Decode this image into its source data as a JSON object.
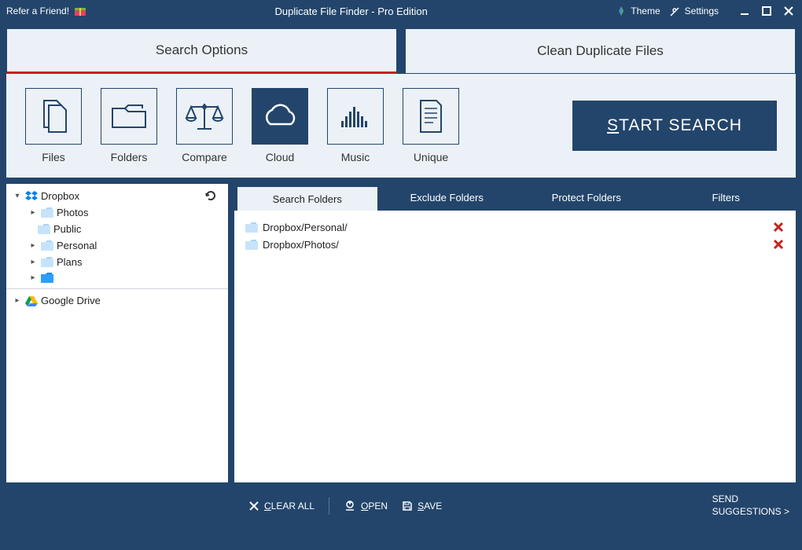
{
  "titlebar": {
    "refer": "Refer a Friend!",
    "app_title": "Duplicate File Finder - Pro Edition",
    "theme": "Theme",
    "settings": "Settings"
  },
  "main_tabs": {
    "search_options": "Search Options",
    "clean_duplicates": "Clean Duplicate Files"
  },
  "toolbar": {
    "files": "Files",
    "folders": "Folders",
    "compare": "Compare",
    "cloud": "Cloud",
    "music": "Music",
    "unique": "Unique",
    "start_prefix": "S",
    "start_rest": "TART SEARCH"
  },
  "tree": {
    "dropbox": "Dropbox",
    "items": [
      "Photos",
      "Public",
      "Personal",
      "Plans"
    ],
    "google_drive": "Google Drive"
  },
  "sub_tabs": {
    "search_folders": "Search Folders",
    "exclude_folders": "Exclude Folders",
    "protect_folders": "Protect Folders",
    "filters": "Filters"
  },
  "folder_list": [
    "Dropbox/Personal/",
    "Dropbox/Photos/"
  ],
  "footer": {
    "clear_prefix": "C",
    "clear_rest": "LEAR ALL",
    "open_prefix": "O",
    "open_rest": "PEN",
    "save_prefix": "S",
    "save_rest": "AVE",
    "suggest_line1": "SEND",
    "suggest_line2": "SUGGESTIONS >"
  }
}
